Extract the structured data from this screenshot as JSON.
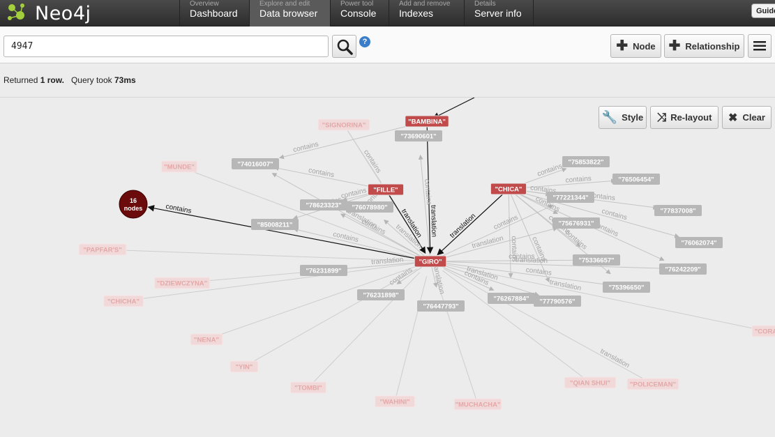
{
  "app": {
    "logo": "Neo4j"
  },
  "nav": [
    {
      "sub": "Overview",
      "main": "Dashboard",
      "active": false
    },
    {
      "sub": "Explore and edit",
      "main": "Data browser",
      "active": true
    },
    {
      "sub": "Power tool",
      "main": "Console",
      "active": false
    },
    {
      "sub": "Add and remove",
      "main": "Indexes",
      "active": false
    },
    {
      "sub": "Details",
      "main": "Server info",
      "active": false
    }
  ],
  "guide_label": "Guide",
  "toolbar": {
    "query_value": "4947",
    "help": "?",
    "node_label": "Node",
    "relationship_label": "Relationship"
  },
  "status": {
    "prefix": "Returned ",
    "rows": "1 row.",
    "mid": "   Query took ",
    "time": "73ms"
  },
  "graph_controls": {
    "style": "Style",
    "relayout": "Re-layout",
    "clear": "Clear"
  },
  "graph": {
    "cluster": {
      "line1": "16",
      "line2": "nodes",
      "edge": "contains"
    },
    "main_nodes": [
      {
        "id": "bambina",
        "label": "\"BAMBINA\""
      },
      {
        "id": "fille",
        "label": "\"FILLE\""
      },
      {
        "id": "chica",
        "label": "\"CHICA\""
      },
      {
        "id": "giro",
        "label": "\"GIRO\""
      }
    ],
    "gray_nodes": [
      {
        "id": "n73690601",
        "label": "\"73690601\""
      },
      {
        "id": "n74016007",
        "label": "\"74016007\""
      },
      {
        "id": "n78623323",
        "label": "\"78623323\""
      },
      {
        "id": "n76078980",
        "label": "\"76078980\""
      },
      {
        "id": "n85008211",
        "label": "\"85008211\""
      },
      {
        "id": "n75853822",
        "label": "\"75853822\""
      },
      {
        "id": "n76506454",
        "label": "\"76506454\""
      },
      {
        "id": "n77221344",
        "label": "\"77221344\""
      },
      {
        "id": "n77837008",
        "label": "\"77837008\""
      },
      {
        "id": "n75676931",
        "label": "\"75676931\""
      },
      {
        "id": "n76062074",
        "label": "\"76062074\""
      },
      {
        "id": "n75336657",
        "label": "\"75336657\""
      },
      {
        "id": "n76242209",
        "label": "\"76242209\""
      },
      {
        "id": "n75396650",
        "label": "\"75396650\""
      },
      {
        "id": "n76231899",
        "label": "\"76231899\""
      },
      {
        "id": "n76231898",
        "label": "\"76231898\""
      },
      {
        "id": "n76447793",
        "label": "\"76447793\""
      },
      {
        "id": "n76267884",
        "label": "\"76267884\""
      },
      {
        "id": "n77790576",
        "label": "\"77790576\""
      }
    ],
    "faded_nodes": [
      {
        "id": "signorina",
        "label": "\"SIGNORINA\""
      },
      {
        "id": "munde",
        "label": "\"MUNDE\""
      },
      {
        "id": "papfar",
        "label": "\"PAPFAR'S\""
      },
      {
        "id": "dziewczyna",
        "label": "\"DZIEWCZYNA\""
      },
      {
        "id": "chicha",
        "label": "\"CHICHA\""
      },
      {
        "id": "nena",
        "label": "\"NENA\""
      },
      {
        "id": "yin",
        "label": "\"YIN\""
      },
      {
        "id": "tombi",
        "label": "\"TOMBI\""
      },
      {
        "id": "wahini",
        "label": "\"WAHINI\""
      },
      {
        "id": "muchacha",
        "label": "\"MUCHACHA\""
      },
      {
        "id": "qianshui",
        "label": "\"QIAN SHUI\""
      },
      {
        "id": "policeman",
        "label": "\"POLICEMAN\""
      },
      {
        "id": "cora",
        "label": "\"CORA"
      }
    ],
    "edge_labels": {
      "contains": "contains",
      "translation": "translation"
    }
  }
}
